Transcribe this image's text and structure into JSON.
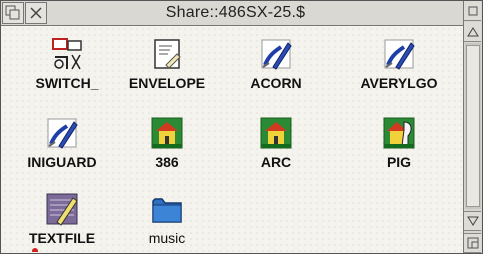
{
  "window": {
    "title": "Share::486SX-25.$"
  },
  "titlebar": {
    "back_icon": "back-icon",
    "close_icon": "close-icon"
  },
  "scrollbar": {
    "up_icon": "arrow-up-icon",
    "down_icon": "arrow-down-icon",
    "toggle_icon": "toggle-size-icon",
    "resize_icon": "resize-icon"
  },
  "icons": [
    {
      "label": "SWITCH_",
      "icon": "switch-app-icon"
    },
    {
      "label": "ENVELOPE",
      "icon": "envelope-icon"
    },
    {
      "label": "ACORN",
      "icon": "drawfile-icon"
    },
    {
      "label": "AVERYLGO",
      "icon": "drawfile-icon"
    },
    {
      "label": "INIGUARD",
      "icon": "drawfile-icon"
    },
    {
      "label": "386",
      "icon": "house-app-icon"
    },
    {
      "label": "ARC",
      "icon": "house-app-icon"
    },
    {
      "label": "PIG",
      "icon": "pig-app-icon"
    },
    {
      "label": "TEXTFILE",
      "icon": "text-file-icon"
    },
    {
      "label": "music",
      "icon": "folder-icon"
    }
  ]
}
